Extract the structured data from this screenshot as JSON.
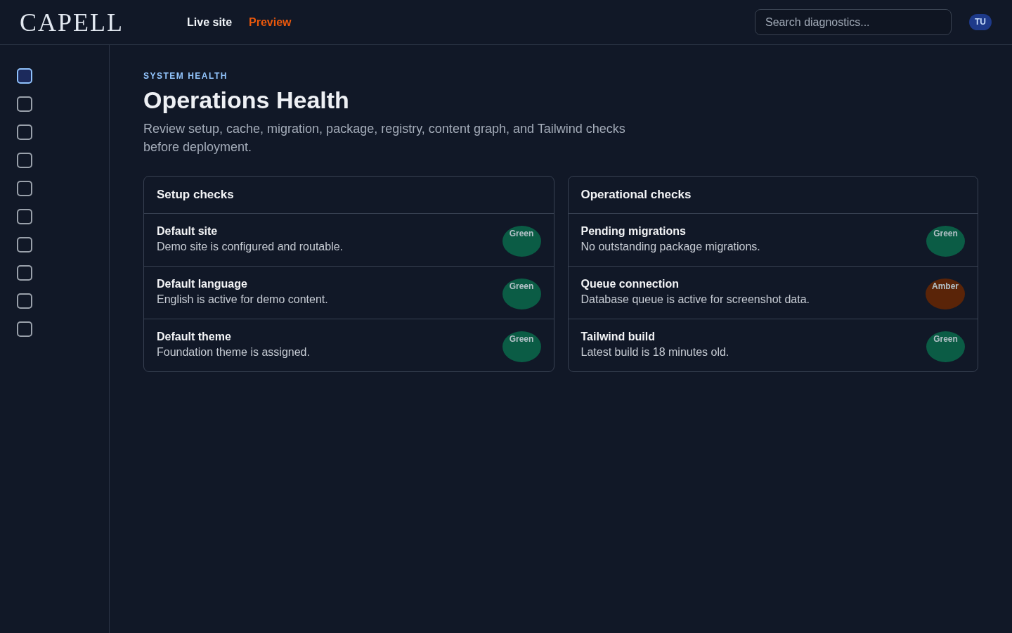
{
  "header": {
    "logo": "CAPELL",
    "nav": [
      {
        "label": "Live site",
        "selected": false
      },
      {
        "label": "Preview",
        "selected": true
      }
    ],
    "search": {
      "placeholder": "Search diagnostics..."
    },
    "avatar": "TU"
  },
  "sidebar": {
    "items": [
      {
        "selected": true
      },
      {
        "selected": false
      },
      {
        "selected": false
      },
      {
        "selected": false
      },
      {
        "selected": false
      },
      {
        "selected": false
      },
      {
        "selected": false
      },
      {
        "selected": false
      },
      {
        "selected": false
      },
      {
        "selected": false
      }
    ]
  },
  "page": {
    "eyebrow": "SYSTEM HEALTH",
    "title": "Operations Health",
    "description": "Review setup, cache, migration, package, registry, content graph, and Tailwind checks before deployment."
  },
  "panels": [
    {
      "title": "Setup checks",
      "checks": [
        {
          "name": "Default site",
          "detail": "Demo site is configured and routable.",
          "status": "Green",
          "color": "#0b5c45"
        },
        {
          "name": "Default language",
          "detail": "English is active for demo content.",
          "status": "Green",
          "color": "#0b5c45"
        },
        {
          "name": "Default theme",
          "detail": "Foundation theme is assigned.",
          "status": "Green",
          "color": "#0b5c45"
        }
      ]
    },
    {
      "title": "Operational checks",
      "checks": [
        {
          "name": "Pending migrations",
          "detail": "No outstanding package migrations.",
          "status": "Green",
          "color": "#0b5c45"
        },
        {
          "name": "Queue connection",
          "detail": "Database queue is active for screenshot data.",
          "status": "Amber",
          "color": "#5a2408"
        },
        {
          "name": "Tailwind build",
          "detail": "Latest build is 18 minutes old.",
          "status": "Green",
          "color": "#0b5c45"
        }
      ]
    }
  ]
}
